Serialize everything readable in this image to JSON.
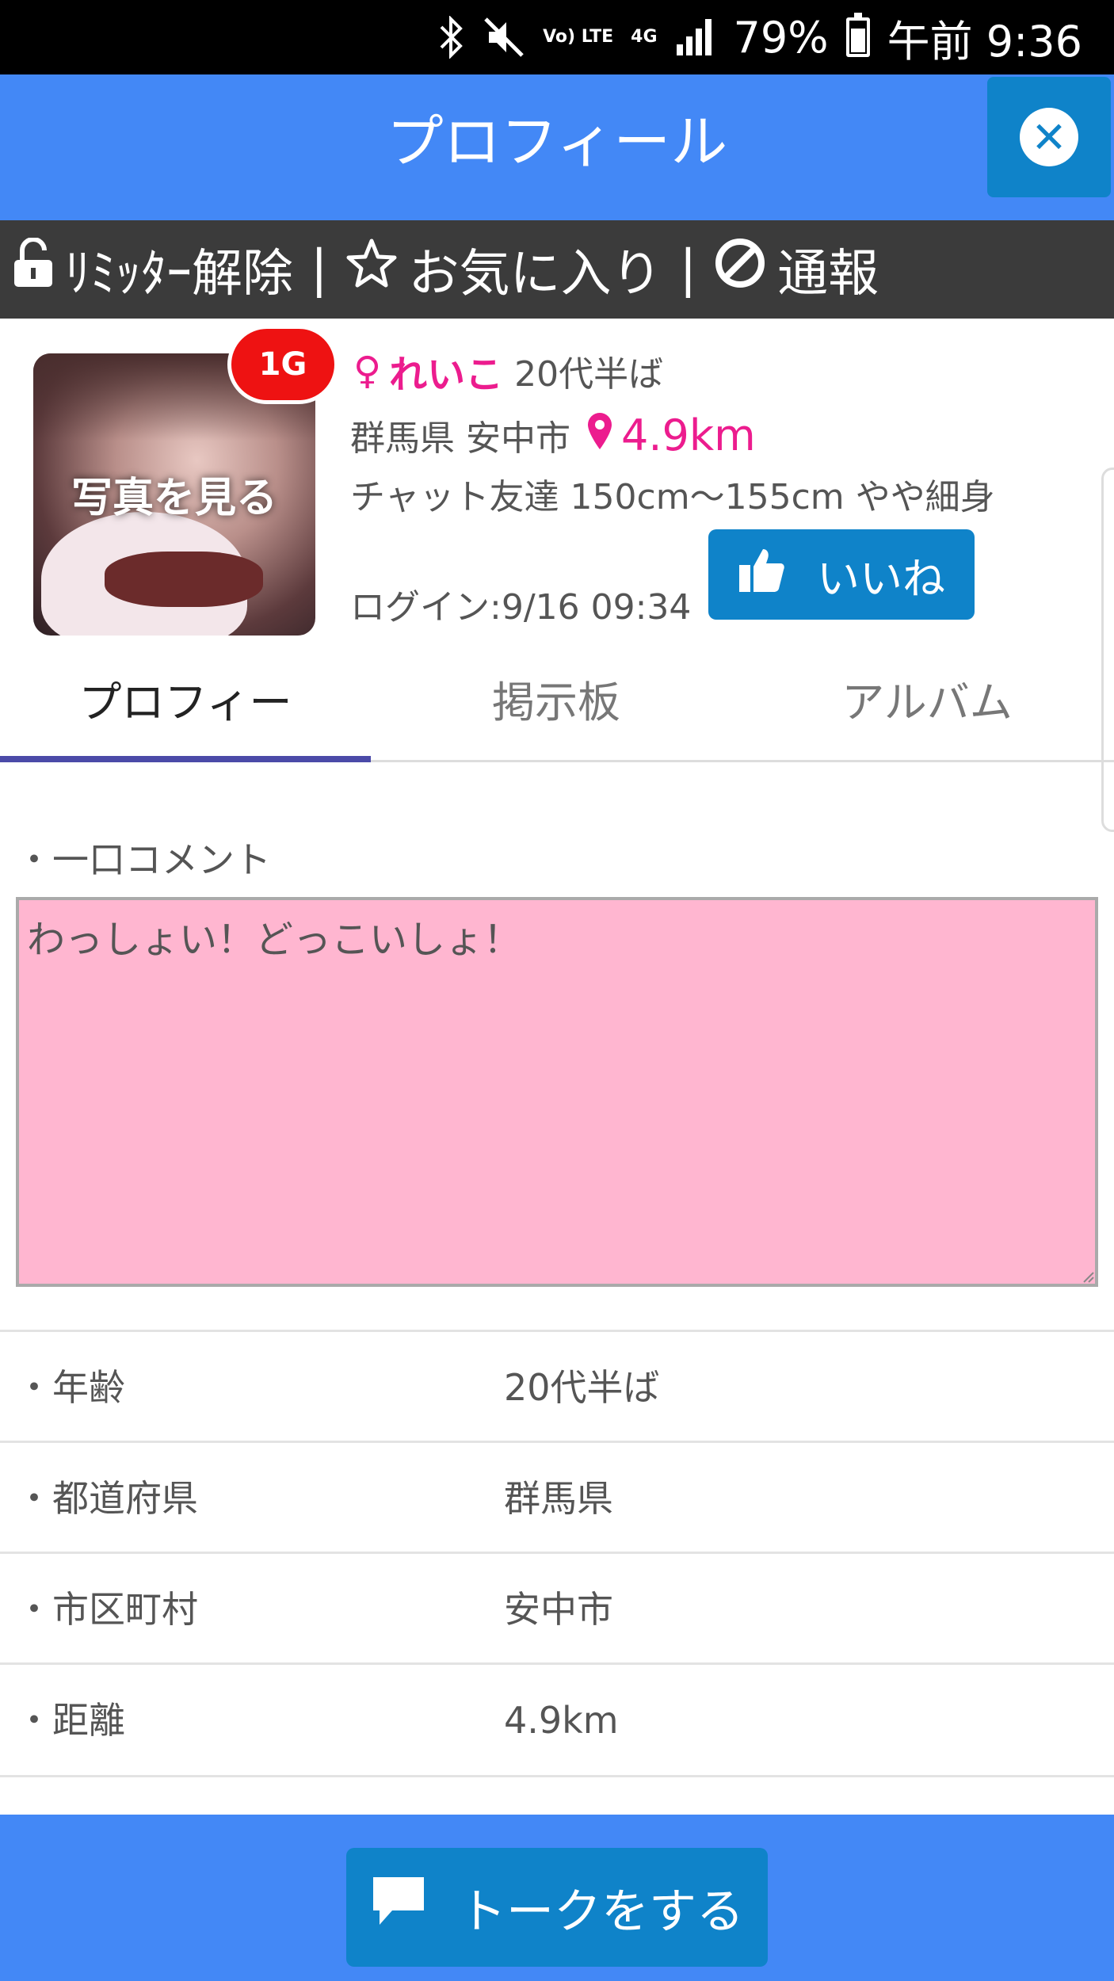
{
  "status_bar": {
    "battery": "79%",
    "time": "午前 9:36",
    "network": "4G",
    "lte_label": "Vo) LTE"
  },
  "header": {
    "title": "プロフィール",
    "close_icon": "close-icon"
  },
  "actions": {
    "limiter": "ﾘﾐｯﾀｰ解除",
    "favorite": "お気に入り",
    "report": "通報",
    "separator": "|"
  },
  "profile": {
    "photo_label": "写真を見る",
    "badge": "1G",
    "gender_symbol": "♀",
    "name": "れいこ",
    "age": "20代半ば",
    "location": "群馬県 安中市",
    "distance": "4.9km",
    "info": "チャット友達  150cm〜155cm  やや細身",
    "login": "ログイン:9/16 09:34",
    "like_label": "いいね"
  },
  "tabs": [
    {
      "label": "プロフィー"
    },
    {
      "label": "掲示板"
    },
    {
      "label": "アルバム"
    }
  ],
  "comment": {
    "label": "・一口コメント",
    "value": "わっしょい！どっこいしょ！"
  },
  "details": [
    {
      "label": "・年齢",
      "value": "20代半ば"
    },
    {
      "label": "・都道府県",
      "value": "群馬県"
    },
    {
      "label": "・市区町村",
      "value": "安中市"
    },
    {
      "label": "・距離",
      "value": "4.9km"
    }
  ],
  "bottom": {
    "talk_label": "トークをする"
  },
  "colors": {
    "header_blue": "#4388f6",
    "button_blue": "#0f83c9",
    "accent_pink": "#ec1c8e",
    "comment_bg": "#ffb6d0",
    "badge_red": "#ee1212"
  }
}
